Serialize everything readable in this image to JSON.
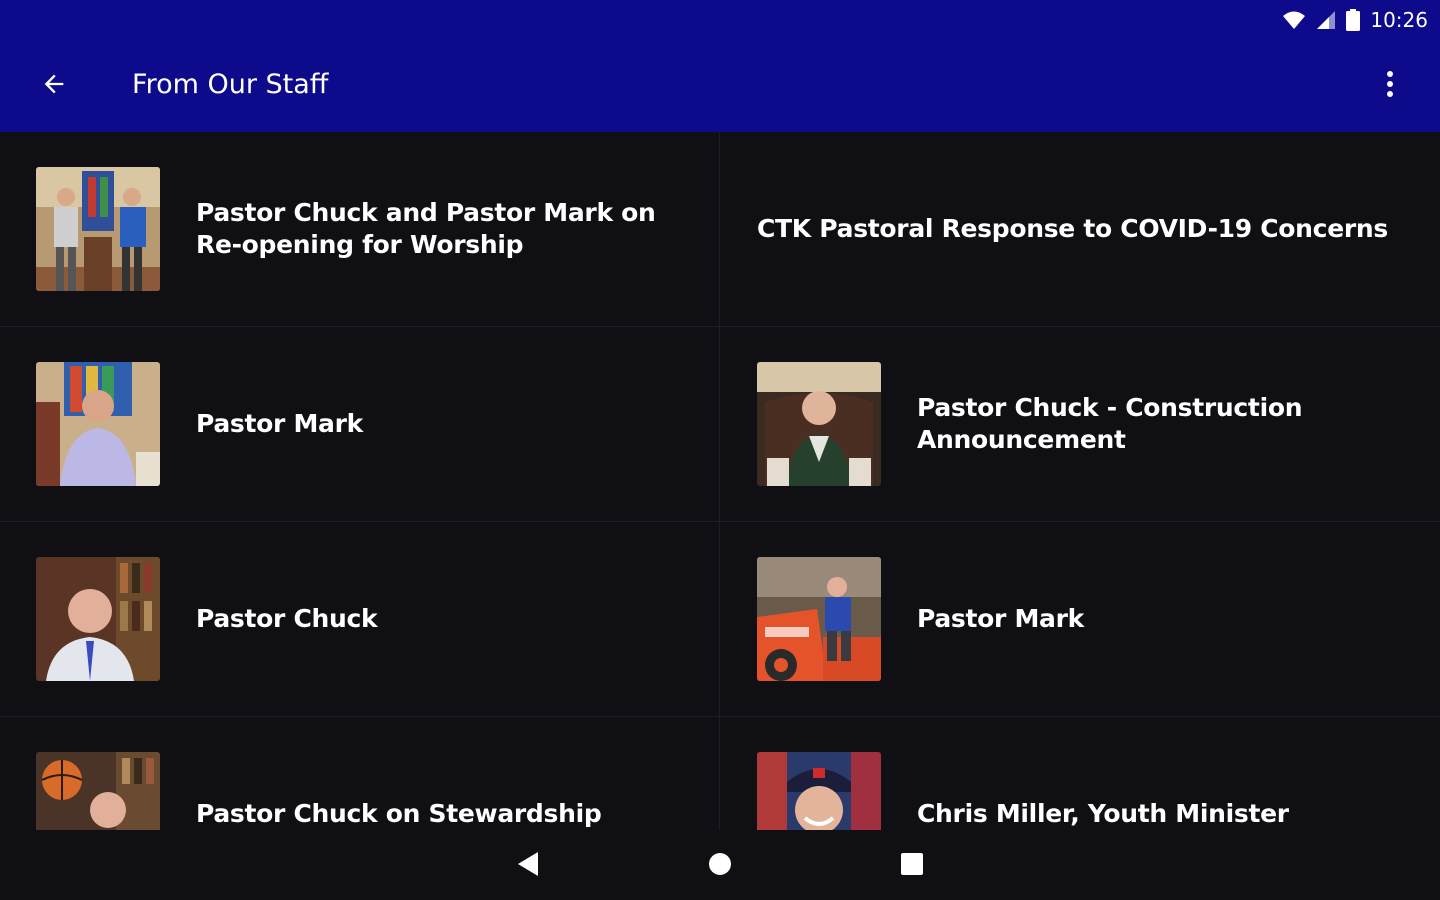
{
  "status_bar": {
    "time": "10:26",
    "icons": [
      "wifi-icon",
      "cellular-signal-icon",
      "battery-icon"
    ]
  },
  "app_bar": {
    "title": "From Our Staff",
    "back_icon": "arrow-back-icon",
    "menu_icon": "more-vertical-icon",
    "background": "#0d0b8c"
  },
  "items": [
    {
      "title": "Pastor Chuck and Pastor Mark on Re-opening for Worship",
      "has_thumbnail": true
    },
    {
      "title": "CTK Pastoral Response to COVID-19 Concerns",
      "has_thumbnail": false
    },
    {
      "title": "Pastor Mark",
      "has_thumbnail": true
    },
    {
      "title": "Pastor Chuck - Construction Announcement",
      "has_thumbnail": true
    },
    {
      "title": "Pastor Chuck",
      "has_thumbnail": true
    },
    {
      "title": "Pastor Mark",
      "has_thumbnail": true
    },
    {
      "title": "Pastor Chuck on Stewardship",
      "has_thumbnail": true
    },
    {
      "title": "Chris Miller, Youth Minister",
      "has_thumbnail": true
    }
  ],
  "nav_bar": {
    "back_icon": "nav-back-triangle-icon",
    "home_icon": "nav-home-circle-icon",
    "recents_icon": "nav-recents-square-icon"
  },
  "colors": {
    "app_bar": "#0d0b8c",
    "background": "#101014",
    "text": "#ffffff",
    "divider": "#1e1f24"
  }
}
